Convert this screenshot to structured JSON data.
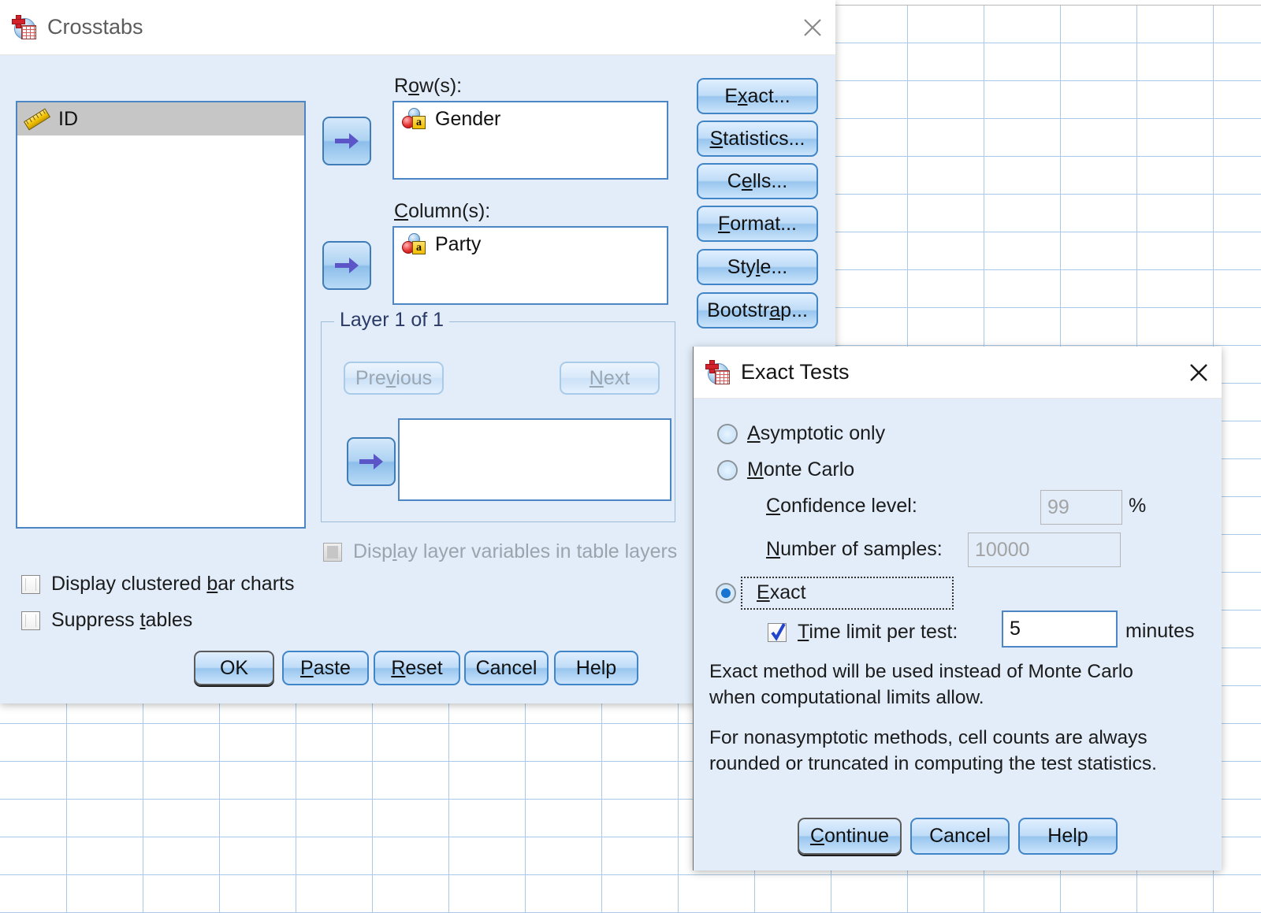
{
  "background": {
    "name": "spss-data-editor-grid"
  },
  "crosstabs": {
    "title": "Crosstabs",
    "close_label": "✕",
    "variable_list": {
      "items": [
        {
          "label": "ID",
          "icon": "scale-ruler-icon",
          "selected": true
        }
      ]
    },
    "rows": {
      "label_pre": "R",
      "label_mn": "o",
      "label_post": "w(s):",
      "items": [
        {
          "label": "Gender",
          "icon": "nominal-string-icon"
        }
      ]
    },
    "columns": {
      "label_pre": "",
      "label_mn": "C",
      "label_post": "olumn(s):",
      "items": [
        {
          "label": "Party",
          "icon": "nominal-string-icon"
        }
      ]
    },
    "layer": {
      "title": "Layer 1 of 1",
      "previous": {
        "pre": "Pre",
        "mn": "v",
        "post": "ious",
        "disabled": true
      },
      "next": {
        "pre": "",
        "mn": "N",
        "post": "ext",
        "disabled": true
      },
      "items": []
    },
    "side_buttons": [
      {
        "pre": "E",
        "mn": "x",
        "post": "act...",
        "name": "exact-button"
      },
      {
        "pre": "",
        "mn": "S",
        "post": "tatistics...",
        "name": "statistics-button"
      },
      {
        "pre": "C",
        "mn": "e",
        "post": "lls...",
        "name": "cells-button"
      },
      {
        "pre": "",
        "mn": "F",
        "post": "ormat...",
        "name": "format-button"
      },
      {
        "pre": "Sty",
        "mn": "l",
        "post": "e...",
        "name": "style-button"
      },
      {
        "pre": "Bootstr",
        "mn": "a",
        "post": "p...",
        "name": "bootstrap-button"
      }
    ],
    "checkboxes": [
      {
        "pre": "Disp",
        "mn": "l",
        "post": "ay layer variables in table layers",
        "checked": false,
        "disabled": true,
        "name": "display-layer-variables-checkbox"
      },
      {
        "pre": "Display clustered ",
        "mn": "b",
        "post": "ar charts",
        "checked": false,
        "disabled": false,
        "name": "display-clustered-bar-charts-checkbox"
      },
      {
        "pre": "Suppress ",
        "mn": "t",
        "post": "ables",
        "checked": false,
        "disabled": false,
        "name": "suppress-tables-checkbox"
      }
    ],
    "action_buttons": [
      {
        "pre": "OK",
        "mn": "",
        "post": "",
        "default": true,
        "name": "ok-button"
      },
      {
        "pre": "",
        "mn": "P",
        "post": "aste",
        "default": false,
        "name": "paste-button"
      },
      {
        "pre": "",
        "mn": "R",
        "post": "eset",
        "default": false,
        "name": "reset-button"
      },
      {
        "pre": "Cancel",
        "mn": "",
        "post": "",
        "default": false,
        "name": "cancel-button"
      },
      {
        "pre": "Help",
        "mn": "",
        "post": "",
        "default": false,
        "name": "help-button"
      }
    ]
  },
  "exact_tests": {
    "title": "Exact Tests",
    "close_label": "✕",
    "options": {
      "asymptotic": {
        "pre": "",
        "mn": "A",
        "post": "symptotic only",
        "selected": false
      },
      "monte_carlo": {
        "pre": "",
        "mn": "M",
        "post": "onte Carlo",
        "selected": false
      },
      "exact": {
        "pre": "",
        "mn": "E",
        "post": "xact",
        "selected": true,
        "focused": true
      }
    },
    "confidence_level": {
      "pre": "",
      "mn": "C",
      "post": "onfidence level:",
      "value": "99",
      "unit": "%",
      "disabled": true
    },
    "number_of_samples": {
      "pre": "",
      "mn": "N",
      "post": "umber of samples:",
      "value": "10000",
      "disabled": true
    },
    "time_limit": {
      "pre": "",
      "mn": "T",
      "post": "ime limit per test:",
      "checked": true,
      "value": "5",
      "unit": "minutes"
    },
    "description": [
      "Exact method will be used instead of Monte Carlo when computational limits allow.",
      "For nonasymptotic methods, cell counts are always rounded or truncated in computing the test statistics."
    ],
    "action_buttons": [
      {
        "pre": "",
        "mn": "C",
        "post": "ontinue",
        "default": true,
        "name": "continue-button"
      },
      {
        "pre": "Cancel",
        "mn": "",
        "post": "",
        "default": false,
        "name": "cancel-button"
      },
      {
        "pre": "Help",
        "mn": "",
        "post": "",
        "default": false,
        "name": "help-button"
      }
    ]
  }
}
